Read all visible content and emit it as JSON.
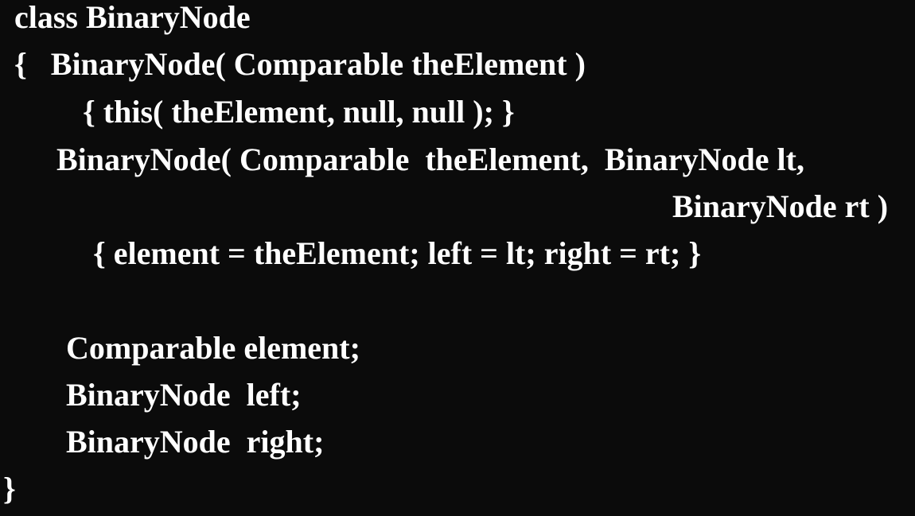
{
  "code_lines": [
    "class BinaryNode",
    "{   BinaryNode( Comparable theElement )",
    "{ this( theElement, null, null ); }",
    "BinaryNode( Comparable  theElement,  BinaryNode lt,",
    "BinaryNode rt )",
    "{ element = theElement; left = lt; right = rt; }",
    "Comparable element;",
    "BinaryNode  left;",
    "BinaryNode  right;",
    "}"
  ],
  "colors": {
    "background": "#0b0b0b",
    "text": "#ffffff"
  }
}
